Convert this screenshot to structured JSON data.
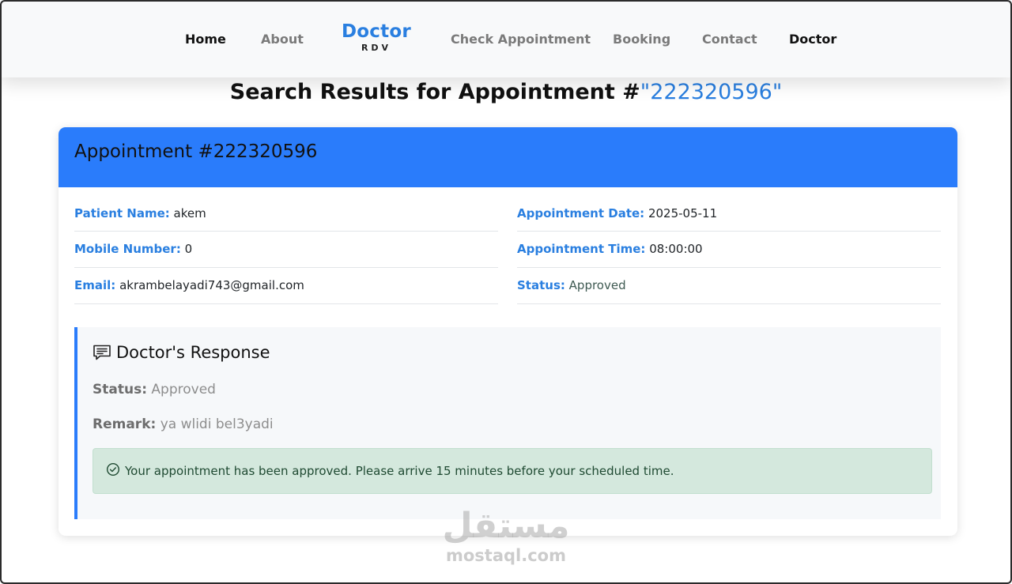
{
  "nav": {
    "items": [
      {
        "label": "Home"
      },
      {
        "label": "About"
      },
      {
        "label": "Check Appointment"
      },
      {
        "label": "Booking"
      },
      {
        "label": "Contact"
      },
      {
        "label": "Doctor"
      }
    ],
    "brand": {
      "main": "Doctor",
      "sub": "RDV"
    }
  },
  "heading": {
    "prefix": "Search Results for Appointment #",
    "number": "\"222320596\""
  },
  "card": {
    "title": "Appointment #222320596",
    "patient_name": {
      "label": "Patient Name:",
      "value": "akem"
    },
    "mobile": {
      "label": "Mobile Number:",
      "value": "0"
    },
    "email": {
      "label": "Email:",
      "value": "akrambelayadi743@gmail.com"
    },
    "date": {
      "label": "Appointment Date:",
      "value": "2025-05-11"
    },
    "time": {
      "label": "Appointment Time:",
      "value": "08:00:00"
    },
    "status": {
      "label": "Status:",
      "value": "Approved"
    }
  },
  "response": {
    "title": "Doctor's Response",
    "status": {
      "label": "Status:",
      "value": "Approved"
    },
    "remark": {
      "label": "Remark:",
      "value": "ya wlidi bel3yadi"
    },
    "alert": "Your appointment has been approved. Please arrive 15 minutes before your scheduled time."
  },
  "watermark": {
    "arabic": "مستقل",
    "latin": "mostaql.com"
  },
  "colors": {
    "accent": "#2a7cfb",
    "link_blue": "#2a7fe0",
    "alert_bg": "#d4e8dd",
    "alert_text": "#1f4a32"
  },
  "icons": {
    "response": "chat-square-text-icon",
    "alert": "check-circle-icon"
  }
}
